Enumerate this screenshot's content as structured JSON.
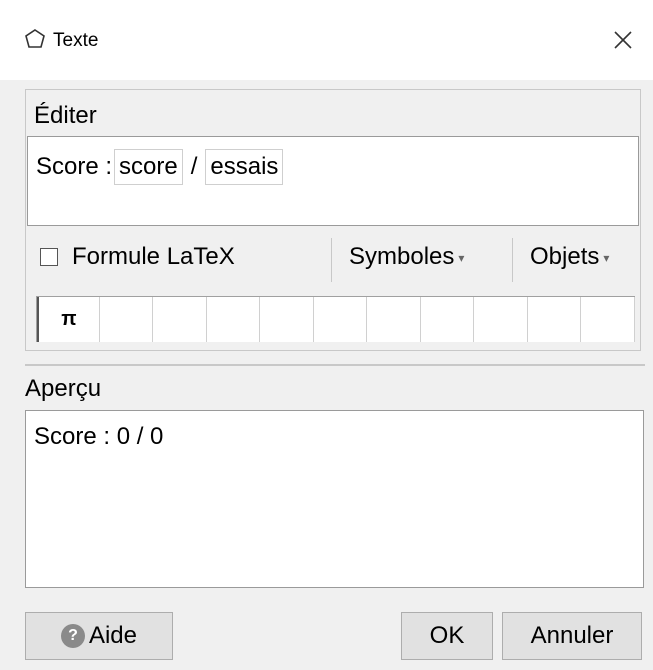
{
  "window": {
    "title": "Texte",
    "title_icon": "polygon-icon",
    "close_icon": "close-icon"
  },
  "edit": {
    "label": "Éditer",
    "prefix": "Score : ",
    "token1": "score",
    "separator": "/",
    "token2": "essais"
  },
  "controls": {
    "latex_label": "Formule LaTeX",
    "latex_checked": false,
    "symbols_label": "Symboles",
    "objects_label": "Objets"
  },
  "symbols": [
    "π",
    "",
    "",
    "",
    "",
    "",
    "",
    "",
    "",
    "",
    ""
  ],
  "preview": {
    "label": "Aperçu",
    "text": "Score : 0 / 0"
  },
  "buttons": {
    "help": "Aide",
    "ok": "OK",
    "cancel": "Annuler"
  }
}
